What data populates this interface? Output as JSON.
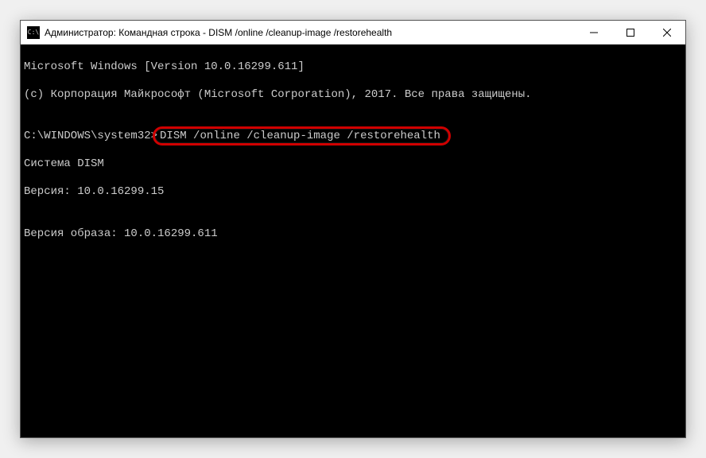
{
  "titlebar": {
    "icon_label": "C:\\",
    "title": "Администратор: Командная строка - DISM  /online /cleanup-image /restorehealth"
  },
  "window_controls": {
    "minimize": "minimize",
    "maximize": "maximize",
    "close": "close"
  },
  "console": {
    "line1": "Microsoft Windows [Version 10.0.16299.611]",
    "line2": "(c) Корпорация Майкрософт (Microsoft Corporation), 2017. Все права защищены.",
    "blank1": "",
    "prompt_path": "C:\\WINDOWS\\system32>",
    "command": "DISM /online /cleanup-image /restorehealth",
    "blank2": "",
    "line3": "Cистема DISM",
    "line4": "Версия: 10.0.16299.15",
    "blank3": "",
    "line5": "Версия образа: 10.0.16299.611"
  }
}
